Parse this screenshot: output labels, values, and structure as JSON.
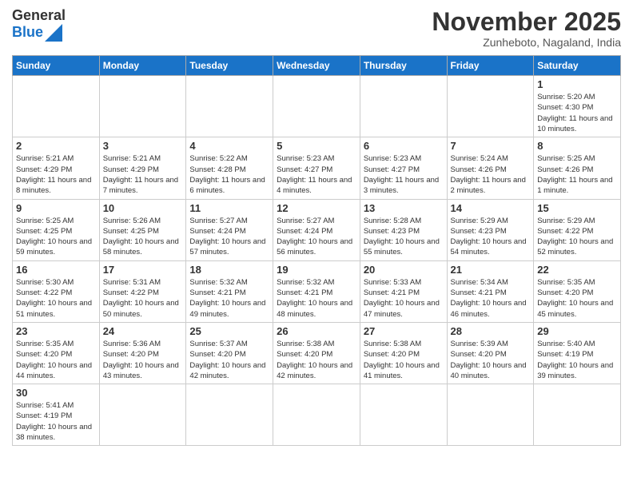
{
  "header": {
    "logo_text_general": "General",
    "logo_text_blue": "Blue",
    "title": "November 2025",
    "subtitle": "Zunheboto, Nagaland, India"
  },
  "weekdays": [
    "Sunday",
    "Monday",
    "Tuesday",
    "Wednesday",
    "Thursday",
    "Friday",
    "Saturday"
  ],
  "weeks": [
    [
      {
        "day": "",
        "info": ""
      },
      {
        "day": "",
        "info": ""
      },
      {
        "day": "",
        "info": ""
      },
      {
        "day": "",
        "info": ""
      },
      {
        "day": "",
        "info": ""
      },
      {
        "day": "",
        "info": ""
      },
      {
        "day": "1",
        "info": "Sunrise: 5:20 AM\nSunset: 4:30 PM\nDaylight: 11 hours and 10 minutes."
      }
    ],
    [
      {
        "day": "2",
        "info": "Sunrise: 5:21 AM\nSunset: 4:29 PM\nDaylight: 11 hours and 8 minutes."
      },
      {
        "day": "3",
        "info": "Sunrise: 5:21 AM\nSunset: 4:29 PM\nDaylight: 11 hours and 7 minutes."
      },
      {
        "day": "4",
        "info": "Sunrise: 5:22 AM\nSunset: 4:28 PM\nDaylight: 11 hours and 6 minutes."
      },
      {
        "day": "5",
        "info": "Sunrise: 5:23 AM\nSunset: 4:27 PM\nDaylight: 11 hours and 4 minutes."
      },
      {
        "day": "6",
        "info": "Sunrise: 5:23 AM\nSunset: 4:27 PM\nDaylight: 11 hours and 3 minutes."
      },
      {
        "day": "7",
        "info": "Sunrise: 5:24 AM\nSunset: 4:26 PM\nDaylight: 11 hours and 2 minutes."
      },
      {
        "day": "8",
        "info": "Sunrise: 5:25 AM\nSunset: 4:26 PM\nDaylight: 11 hours and 1 minute."
      }
    ],
    [
      {
        "day": "9",
        "info": "Sunrise: 5:25 AM\nSunset: 4:25 PM\nDaylight: 10 hours and 59 minutes."
      },
      {
        "day": "10",
        "info": "Sunrise: 5:26 AM\nSunset: 4:25 PM\nDaylight: 10 hours and 58 minutes."
      },
      {
        "day": "11",
        "info": "Sunrise: 5:27 AM\nSunset: 4:24 PM\nDaylight: 10 hours and 57 minutes."
      },
      {
        "day": "12",
        "info": "Sunrise: 5:27 AM\nSunset: 4:24 PM\nDaylight: 10 hours and 56 minutes."
      },
      {
        "day": "13",
        "info": "Sunrise: 5:28 AM\nSunset: 4:23 PM\nDaylight: 10 hours and 55 minutes."
      },
      {
        "day": "14",
        "info": "Sunrise: 5:29 AM\nSunset: 4:23 PM\nDaylight: 10 hours and 54 minutes."
      },
      {
        "day": "15",
        "info": "Sunrise: 5:29 AM\nSunset: 4:22 PM\nDaylight: 10 hours and 52 minutes."
      }
    ],
    [
      {
        "day": "16",
        "info": "Sunrise: 5:30 AM\nSunset: 4:22 PM\nDaylight: 10 hours and 51 minutes."
      },
      {
        "day": "17",
        "info": "Sunrise: 5:31 AM\nSunset: 4:22 PM\nDaylight: 10 hours and 50 minutes."
      },
      {
        "day": "18",
        "info": "Sunrise: 5:32 AM\nSunset: 4:21 PM\nDaylight: 10 hours and 49 minutes."
      },
      {
        "day": "19",
        "info": "Sunrise: 5:32 AM\nSunset: 4:21 PM\nDaylight: 10 hours and 48 minutes."
      },
      {
        "day": "20",
        "info": "Sunrise: 5:33 AM\nSunset: 4:21 PM\nDaylight: 10 hours and 47 minutes."
      },
      {
        "day": "21",
        "info": "Sunrise: 5:34 AM\nSunset: 4:21 PM\nDaylight: 10 hours and 46 minutes."
      },
      {
        "day": "22",
        "info": "Sunrise: 5:35 AM\nSunset: 4:20 PM\nDaylight: 10 hours and 45 minutes."
      }
    ],
    [
      {
        "day": "23",
        "info": "Sunrise: 5:35 AM\nSunset: 4:20 PM\nDaylight: 10 hours and 44 minutes."
      },
      {
        "day": "24",
        "info": "Sunrise: 5:36 AM\nSunset: 4:20 PM\nDaylight: 10 hours and 43 minutes."
      },
      {
        "day": "25",
        "info": "Sunrise: 5:37 AM\nSunset: 4:20 PM\nDaylight: 10 hours and 42 minutes."
      },
      {
        "day": "26",
        "info": "Sunrise: 5:38 AM\nSunset: 4:20 PM\nDaylight: 10 hours and 42 minutes."
      },
      {
        "day": "27",
        "info": "Sunrise: 5:38 AM\nSunset: 4:20 PM\nDaylight: 10 hours and 41 minutes."
      },
      {
        "day": "28",
        "info": "Sunrise: 5:39 AM\nSunset: 4:20 PM\nDaylight: 10 hours and 40 minutes."
      },
      {
        "day": "29",
        "info": "Sunrise: 5:40 AM\nSunset: 4:19 PM\nDaylight: 10 hours and 39 minutes."
      }
    ],
    [
      {
        "day": "30",
        "info": "Sunrise: 5:41 AM\nSunset: 4:19 PM\nDaylight: 10 hours and 38 minutes."
      },
      {
        "day": "",
        "info": ""
      },
      {
        "day": "",
        "info": ""
      },
      {
        "day": "",
        "info": ""
      },
      {
        "day": "",
        "info": ""
      },
      {
        "day": "",
        "info": ""
      },
      {
        "day": "",
        "info": ""
      }
    ]
  ]
}
